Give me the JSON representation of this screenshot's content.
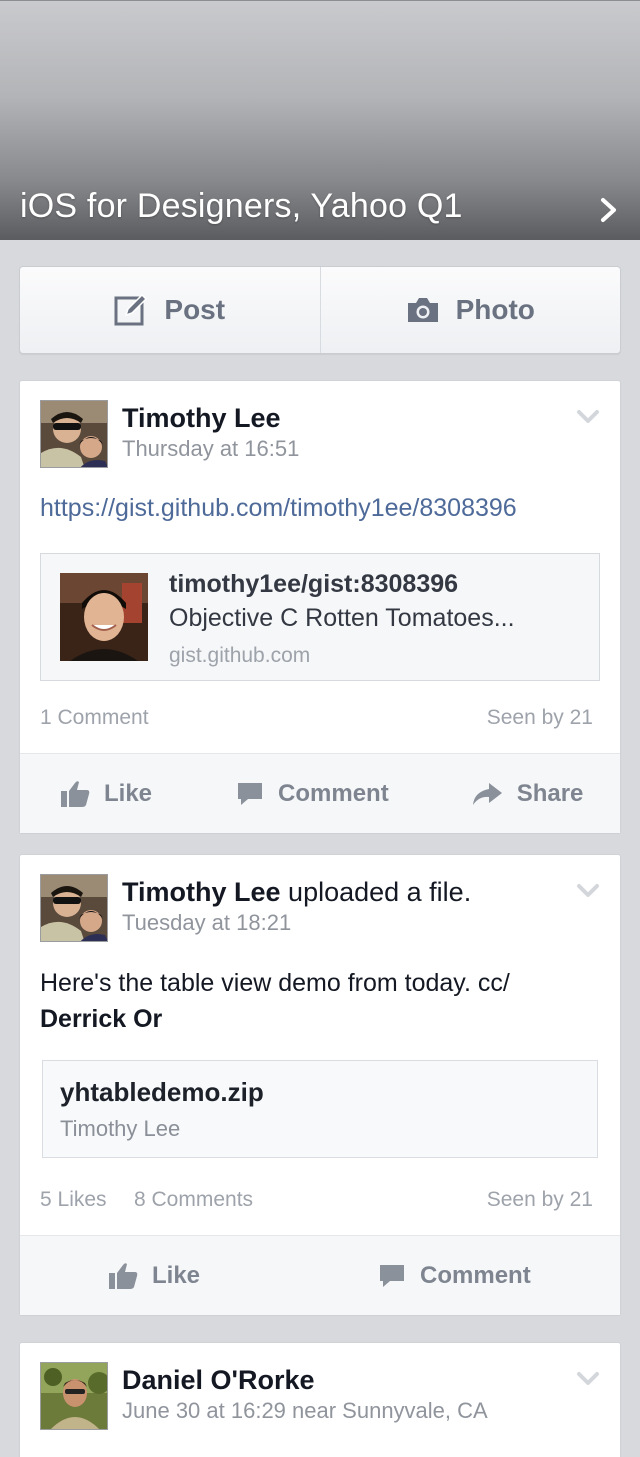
{
  "group": {
    "title": "iOS for Designers, Yahoo Q1"
  },
  "composer": {
    "post_label": "Post",
    "photo_label": "Photo"
  },
  "posts": [
    {
      "author": "Timothy Lee",
      "action": "",
      "time": "Thursday at 16:51",
      "link": "https://gist.github.com/timothy1ee/8308396",
      "attachment": {
        "title": "timothy1ee/gist:8308396",
        "description": "Objective C Rotten Tomatoes...",
        "domain": "gist.github.com"
      },
      "stats": {
        "comments": "1 Comment",
        "seen": "Seen by 21"
      },
      "actions": {
        "like": "Like",
        "comment": "Comment",
        "share": "Share"
      }
    },
    {
      "author": "Timothy Lee",
      "action": " uploaded a file.",
      "time": "Tuesday at 18:21",
      "text": "Here's the table view demo from today. cc/",
      "mention": "Derrick Or",
      "file": {
        "name": "yhtabledemo.zip",
        "owner": "Timothy Lee"
      },
      "stats": {
        "likes": "5 Likes",
        "comments": "8 Comments",
        "seen": "Seen by 21"
      },
      "actions": {
        "like": "Like",
        "comment": "Comment"
      }
    },
    {
      "author": "Daniel O'Rorke",
      "time": "June 30 at 16:29 near Sunnyvale, CA"
    }
  ],
  "colors": {
    "link": "#4e6a99",
    "background": "#d7d9dd",
    "secondary_text": "#90949c"
  }
}
